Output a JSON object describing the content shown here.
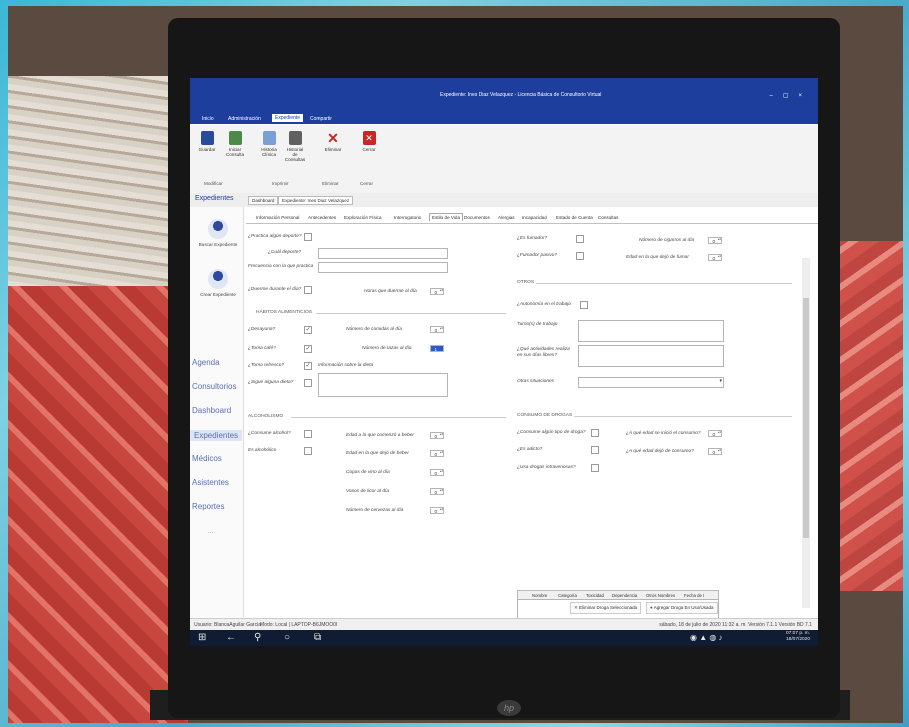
{
  "window": {
    "title": "Expediente: Ines Diaz Velazquez - Licencia Básica de Consultorio Virtual"
  },
  "menu": [
    "Inicio",
    "Administración",
    "Expediente",
    "Compartir"
  ],
  "ribbon": {
    "buttons": [
      "Guardar",
      "Iniciar Consulta",
      "Historia Clínica",
      "Historial de Consultas",
      "Eliminar",
      "Cerrar"
    ],
    "groups": [
      "Modificar",
      "Imprimir",
      "Eliminar",
      "Cerrar"
    ]
  },
  "nav": {
    "title": "Expedientes",
    "tabs": [
      "Dashboard",
      "Expediente: Ines Diaz Velazquez"
    ]
  },
  "sidebar": {
    "buttons": [
      "Buscar Expediente",
      "Crear Expediente"
    ],
    "links": [
      "Agenda",
      "Consultorios",
      "Dashboard",
      "Expedientes",
      "Médicos",
      "Asistentes",
      "Reportes"
    ],
    "more": "..."
  },
  "subtabs": [
    "Información Personal",
    "Antecedentes",
    "Exploración Física",
    "Interrogatorio",
    "Estilo de Vida",
    "Documentos",
    "Alergias",
    "Incapacidad",
    "Estado de Cuenta",
    "Consultas"
  ],
  "left": {
    "practica_deporte": "¿Practica algún deporte?",
    "cual_deporte": "¿Cuál deporte?",
    "frecuencia": "Frecuencia con la que practica",
    "duerme_dia": "¿Duerme durante el día?",
    "horas_duerme": "Horas que duerme al día",
    "horas_duerme_val": "0",
    "habitos_title": "HÁBITOS ALIMENTICIOS",
    "desayuna": "¿Desayuna?",
    "toma_cafe": "¿Toma café?",
    "toma_refresco": "¿Toma refresco?",
    "sigue_dieta": "¿Sigue alguna dieta?",
    "num_comidas": "Número de comidas al día",
    "num_comidas_val": "3",
    "num_tazas": "Número de tazas al día",
    "num_tazas_val": "1",
    "info_dieta": "Información sobre la dieta",
    "alcoholismo_title": "ALCOHOLISMO",
    "consume_alcohol": "¿Consume alcohol?",
    "es_alcoholico": "Es alcohólico",
    "edad_comenzo": "Edad a la que comenzó a beber",
    "edad_dejo": "Edad en la que dejó de beber",
    "copas_vino": "Copas de vino al día",
    "vasos_licor": "Vasos de licor al día",
    "num_cervezas": "Número de cervezas al día",
    "zero": "0"
  },
  "right": {
    "es_fumador": "¿Es fumador?",
    "fumador_pasivo": "¿Fumador pasivo?",
    "num_cigarros": "Número de cigarros al día",
    "edad_dejo_fumar": "Edad en la que dejó de fumar",
    "otros_title": "OTROS",
    "autonomia": "¿Autonomía en el trabajo",
    "turnos": "Turno(s) de trabajo",
    "actividades": "¿Qué actividades realiza en sus días libres?",
    "otras_situaciones": "Otras situaciones",
    "drogas_title": "CONSUMO DE DROGAS",
    "consume_droga": "¿Consume algún tipo de droga?",
    "es_adicto": "¿Es adicto?",
    "drogas_intravenosas": "¿Usa drogas intravenosas?",
    "edad_inicio": "¿A qué edad se inició el consumo?",
    "edad_dejo_consumo": "¿A qué edad dejó de consumo?",
    "zero": "0",
    "grid_headers": [
      "Nombre",
      "Categoría",
      "Toxicidad",
      "Dependencia",
      "Otros Nombres",
      "Fecha de I"
    ],
    "btn_eliminar": "Eliminar Droga Seleccionada",
    "btn_agregar": "Agregar Droga En Uso/Usada"
  },
  "status": {
    "usuario": "Usuario: BlancaAguilar Garcia",
    "modo": "Modo: Local | LAPTOP-B6JMOO0I",
    "fecha": "sábado, 18 de julio de 2020   11:32 a. m.   Versión 7.1.1   Versión BD 7.1"
  },
  "clock": {
    "time": "07:07 p. m.",
    "date": "18/07/2020"
  },
  "colors": {
    "titlebar": "#1e3e9e",
    "accent": "#2d59c4",
    "taskbar": "#0f1c33"
  }
}
